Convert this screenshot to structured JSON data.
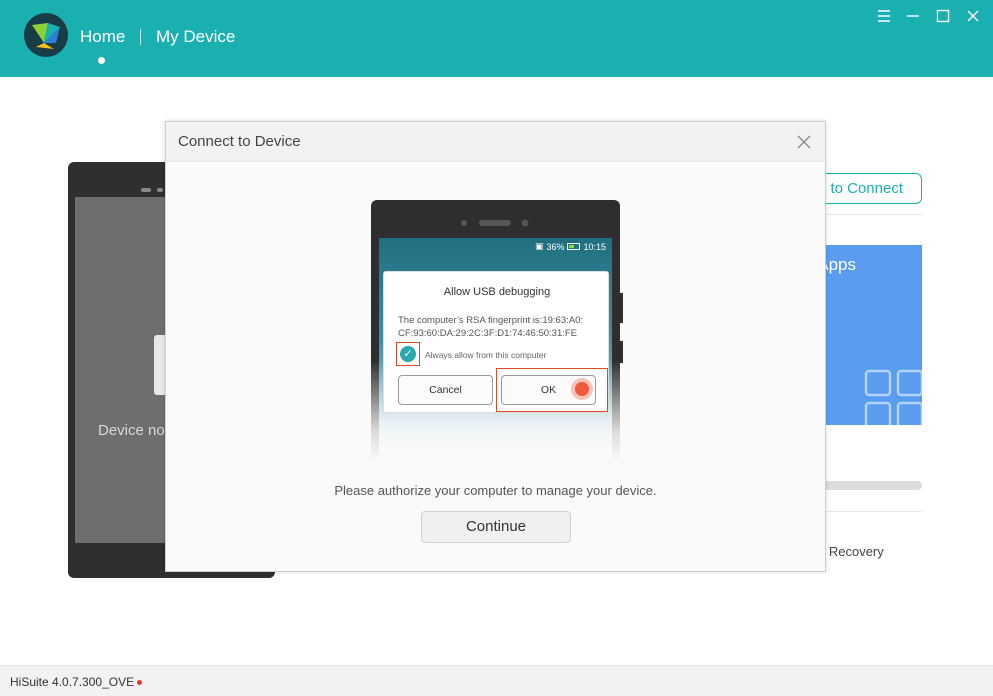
{
  "header": {
    "nav_home": "Home",
    "nav_device": "My Device"
  },
  "background": {
    "device_status": "Device no",
    "connect_label": "to Connect",
    "apps_label": "Apps",
    "recovery_label": "n Recovery"
  },
  "dialog": {
    "title": "Connect to Device",
    "phone": {
      "status_battery": "36%",
      "status_time": "10:15",
      "usb_title": "Allow USB debugging",
      "fingerprint_line1": "The computer’s RSA fingerprint is:19:63:A0:",
      "fingerprint_line2": "CF:93:60:DA:29:2C:3F:D1:74:46:50:31:FE",
      "always_allow": "Always allow from this computer",
      "cancel": "Cancel",
      "ok": "OK"
    },
    "instruction": "Please authorize your computer to manage your device.",
    "continue": "Continue"
  },
  "footer": {
    "version": "HiSuite 4.0.7.300_OVE"
  },
  "colors": {
    "brand": "#1bb0b0",
    "highlight": "#e04a20",
    "apps_tile": "#5a9cf0"
  }
}
